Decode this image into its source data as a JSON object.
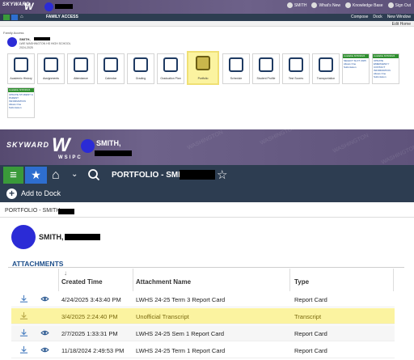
{
  "top": {
    "logo": "SKYWARD",
    "logo_mark": "W",
    "header_right": [
      "SMITH",
      "What's New",
      "Knowledge Base",
      "Sign Out"
    ],
    "nav_title": "FAMILY ACCESS",
    "nav_right": [
      "Compose",
      "Dock",
      "New Window"
    ],
    "strip_right": "Edit Home",
    "breadcrumb": "Family Access",
    "student_name": "SMITH,",
    "student_line1": "LWE WASHINGTON HS HIGH SCHOOL",
    "student_line2": "2024-2025",
    "tiles": [
      {
        "label": "Academic History",
        "icon": "history-icon"
      },
      {
        "label": "Assignments",
        "icon": "assignments-icon"
      },
      {
        "label": "Attendance",
        "icon": "attendance-icon"
      },
      {
        "label": "Calendar",
        "icon": "calendar-icon"
      },
      {
        "label": "Grading",
        "icon": "grading-icon"
      },
      {
        "label": "Graduation Plan",
        "icon": "graduation-cap-icon"
      },
      {
        "label": "Portfolio",
        "icon": "folder-icon"
      },
      {
        "label": "Schedule",
        "icon": "schedule-icon"
      },
      {
        "label": "Student Profile",
        "icon": "profile-icon"
      },
      {
        "label": "Test Scores",
        "icon": "test-scores-icon"
      },
      {
        "label": "Transportation",
        "icon": "bus-icon"
      }
    ],
    "notices": [
      {
        "header": "Available 8/15/2024",
        "body": "SELECT SLOT 2025 Allows One Submission"
      },
      {
        "header": "Available 8/15/2024",
        "body": "UPDATE EMERGENCY CONTACT INFORMATION Allows One Submission"
      },
      {
        "header": "Available 8/15/2024",
        "body": "UPDATE STUDENT & PARENT INFORMATION Allows One Submission"
      }
    ]
  },
  "bottom": {
    "logo": "SKYWARD",
    "logo_mark": "W",
    "wsipc": "WSIPC",
    "header_name": "SMITH,",
    "page_title": "PORTFOLIO - SMITH,",
    "dock_label": "Add to Dock",
    "breadcrumb": "PORTFOLIO - SMITH,",
    "student_name": "SMITH,",
    "section_title": "ATTACHMENTS",
    "columns": [
      "Created Time",
      "Attachment Name",
      "Type"
    ],
    "rows": [
      {
        "created": "4/24/2025 3:43:40 PM",
        "name": "LWHS 24-25 Term 3 Report Card",
        "type": "Report Card",
        "highlight": false
      },
      {
        "created": "3/4/2025 2:24:40 PM",
        "name": "Unofficial Transcript",
        "type": "Transcript",
        "highlight": true
      },
      {
        "created": "2/7/2025 1:33:31 PM",
        "name": "LWHS 24-25 Sem 1 Report Card",
        "type": "Report Card",
        "highlight": false
      },
      {
        "created": "11/18/2024 2:49:53 PM",
        "name": "LWHS 24-25 Term 1 Report Card",
        "type": "Report Card",
        "highlight": false
      }
    ]
  },
  "colors": {
    "header_purple": "#5d5179",
    "nav_dark": "#2d3d51",
    "btn_green": "#3a9a3a",
    "btn_blue": "#2e6ecf",
    "avatar_blue": "#2b2bd6",
    "highlight_yellow": "#fbf3a0",
    "section_title": "#1d4e8a"
  }
}
